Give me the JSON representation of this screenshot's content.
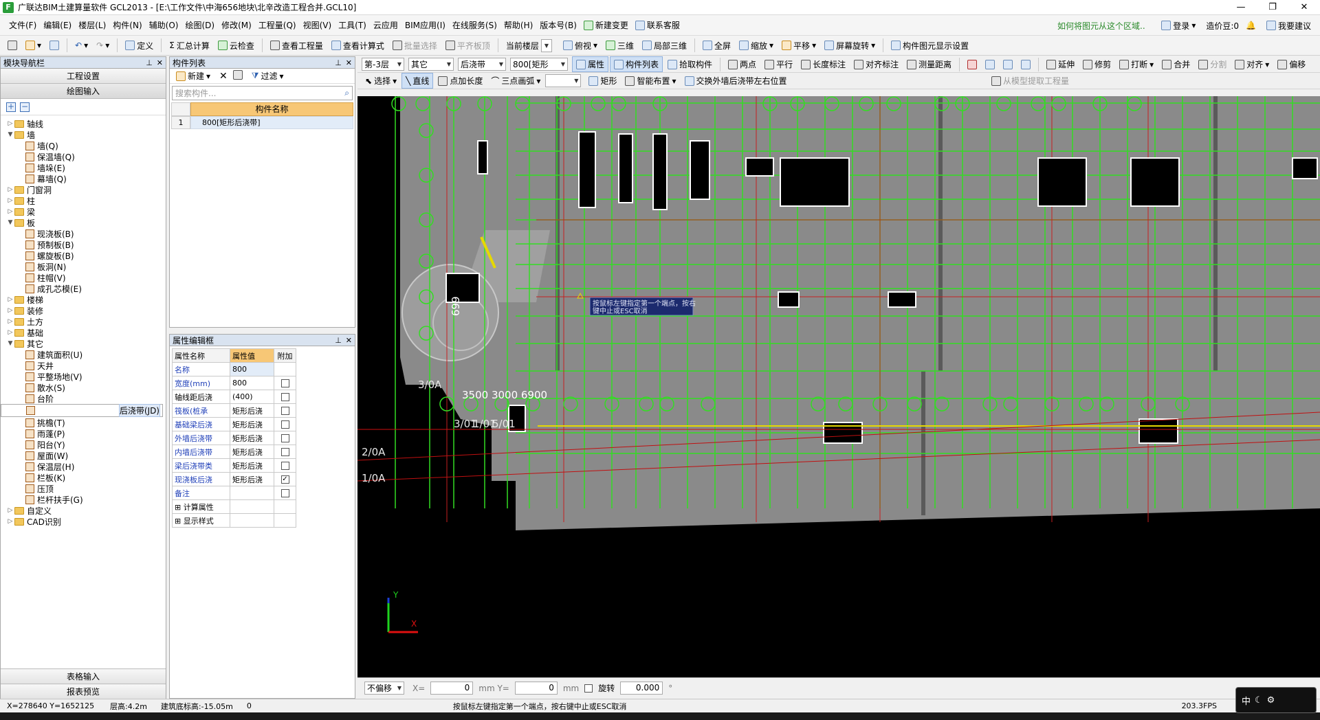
{
  "window": {
    "title": "广联达BIM土建算量软件 GCL2013 - [E:\\工作文件\\中海656地块\\北辛改造工程合并.GCL10]",
    "app_icon": "F",
    "minimize": "—",
    "restore": "❐",
    "close": "✕"
  },
  "menu": {
    "items": [
      "文件(F)",
      "编辑(E)",
      "楼层(L)",
      "构件(N)",
      "辅助(O)",
      "绘图(D)",
      "修改(M)",
      "工程量(Q)",
      "视图(V)",
      "工具(T)",
      "云应用",
      "BIM应用(I)",
      "在线服务(S)",
      "帮助(H)",
      "版本号(B)"
    ],
    "new_change": "新建变更",
    "contact_service": "联系客服",
    "hint_link": "如何将图元从这个区域..",
    "login": "登录",
    "cost_beans": "造价豆:0",
    "suggest": "我要建议"
  },
  "toolbar": {
    "define": "定义",
    "sum_calc": "汇总计算",
    "cloud_check": "云检查",
    "view_quantity": "查看工程量",
    "view_formula": "查看计算式",
    "batch_select": "批量选择",
    "level_slab": "平齐板顶",
    "current_floor": "当前楼层",
    "plan_view": "俯视",
    "three_d": "三维",
    "local_3d": "局部三维",
    "fullscreen": "全屏",
    "zoom": "缩放",
    "pan": "平移",
    "rotate_screen": "屏幕旋转",
    "display_settings": "构件图元显示设置"
  },
  "nav_panel": {
    "title": "模块导航栏",
    "project_settings": "工程设置",
    "drawing_input": "绘图输入",
    "tree": [
      {
        "label": "轴线",
        "level": 0,
        "expanded": false,
        "type": "folder"
      },
      {
        "label": "墙",
        "level": 0,
        "expanded": true,
        "type": "folder"
      },
      {
        "label": "墙(Q)",
        "level": 1,
        "type": "item"
      },
      {
        "label": "保温墙(Q)",
        "level": 1,
        "type": "item"
      },
      {
        "label": "墙垛(E)",
        "level": 1,
        "type": "item"
      },
      {
        "label": "幕墙(Q)",
        "level": 1,
        "type": "item"
      },
      {
        "label": "门窗洞",
        "level": 0,
        "expanded": false,
        "type": "folder"
      },
      {
        "label": "柱",
        "level": 0,
        "expanded": false,
        "type": "folder"
      },
      {
        "label": "梁",
        "level": 0,
        "expanded": false,
        "type": "folder"
      },
      {
        "label": "板",
        "level": 0,
        "expanded": true,
        "type": "folder"
      },
      {
        "label": "现浇板(B)",
        "level": 1,
        "type": "item"
      },
      {
        "label": "预制板(B)",
        "level": 1,
        "type": "item"
      },
      {
        "label": "螺旋板(B)",
        "level": 1,
        "type": "item"
      },
      {
        "label": "板洞(N)",
        "level": 1,
        "type": "item"
      },
      {
        "label": "柱帽(V)",
        "level": 1,
        "type": "item"
      },
      {
        "label": "成孔芯模(E)",
        "level": 1,
        "type": "item"
      },
      {
        "label": "楼梯",
        "level": 0,
        "expanded": false,
        "type": "folder"
      },
      {
        "label": "装修",
        "level": 0,
        "expanded": false,
        "type": "folder"
      },
      {
        "label": "土方",
        "level": 0,
        "expanded": false,
        "type": "folder"
      },
      {
        "label": "基础",
        "level": 0,
        "expanded": false,
        "type": "folder"
      },
      {
        "label": "其它",
        "level": 0,
        "expanded": true,
        "type": "folder"
      },
      {
        "label": "建筑面积(U)",
        "level": 1,
        "type": "item"
      },
      {
        "label": "天井",
        "level": 1,
        "type": "item"
      },
      {
        "label": "平整场地(V)",
        "level": 1,
        "type": "item"
      },
      {
        "label": "散水(S)",
        "level": 1,
        "type": "item"
      },
      {
        "label": "台阶",
        "level": 1,
        "type": "item"
      },
      {
        "label": "后浇带(JD)",
        "level": 1,
        "type": "item",
        "selected": true
      },
      {
        "label": "挑檐(T)",
        "level": 1,
        "type": "item"
      },
      {
        "label": "雨蓬(P)",
        "level": 1,
        "type": "item"
      },
      {
        "label": "阳台(Y)",
        "level": 1,
        "type": "item"
      },
      {
        "label": "屋面(W)",
        "level": 1,
        "type": "item"
      },
      {
        "label": "保温层(H)",
        "level": 1,
        "type": "item"
      },
      {
        "label": "栏板(K)",
        "level": 1,
        "type": "item"
      },
      {
        "label": "压顶",
        "level": 1,
        "type": "item"
      },
      {
        "label": "栏杆扶手(G)",
        "level": 1,
        "type": "item"
      },
      {
        "label": "自定义",
        "level": 0,
        "expanded": false,
        "type": "folder"
      },
      {
        "label": "CAD识别",
        "level": 0,
        "expanded": false,
        "type": "folder"
      }
    ],
    "table_input": "表格输入",
    "report_preview": "报表预览"
  },
  "component_list": {
    "title": "构件列表",
    "new": "新建",
    "filter": "过滤",
    "search_placeholder": "搜索构件...",
    "col_header": "构件名称",
    "rows": [
      {
        "index": "1",
        "name": "800[矩形后浇带]"
      }
    ]
  },
  "property_editor": {
    "title": "属性编辑框",
    "headers": [
      "属性名称",
      "属性值",
      "附加"
    ],
    "rows": [
      {
        "name": "名称",
        "value": "800",
        "extra": "",
        "blue": true
      },
      {
        "name": "宽度(mm)",
        "value": "800",
        "extra": "box",
        "blue": true
      },
      {
        "name": "轴线距后浇",
        "value": "(400)",
        "extra": "box",
        "blue": false
      },
      {
        "name": "筏板(桩承",
        "value": "矩形后浇",
        "extra": "box",
        "blue": true
      },
      {
        "name": "基础梁后浇",
        "value": "矩形后浇",
        "extra": "box",
        "blue": true
      },
      {
        "name": "外墙后浇带",
        "value": "矩形后浇",
        "extra": "box",
        "blue": true
      },
      {
        "name": "内墙后浇带",
        "value": "矩形后浇",
        "extra": "box",
        "blue": true
      },
      {
        "name": "梁后浇带类",
        "value": "矩形后浇",
        "extra": "box",
        "blue": true
      },
      {
        "name": "现浇板后浇",
        "value": "矩形后浇",
        "extra": "checked",
        "blue": true
      },
      {
        "name": "备注",
        "value": "",
        "extra": "box",
        "blue": true
      },
      {
        "name": "计算属性",
        "value": "",
        "extra": "",
        "blue": false,
        "group": true
      },
      {
        "name": "显示样式",
        "value": "",
        "extra": "",
        "blue": false,
        "group": true
      }
    ]
  },
  "draw_toolbar1": {
    "floor": "第-3层",
    "category": "其它",
    "type": "后浇带",
    "component": "800[矩形",
    "properties": "属性",
    "comp_list": "构件列表",
    "pick": "拾取构件",
    "two_points": "两点",
    "parallel": "平行",
    "length_mark": "长度标注",
    "align_mark": "对齐标注",
    "measure": "测量距离",
    "extend": "延伸",
    "trim": "修剪",
    "break": "打断",
    "merge": "合并",
    "split": "分割",
    "align": "对齐",
    "offset": "偏移"
  },
  "draw_toolbar2": {
    "select": "选择",
    "line": "直线",
    "point_length": "点加长度",
    "three_point_arc": "三点画弧",
    "rect": "矩形",
    "smart_layout": "智能布置",
    "swap_sides": "交换外墙后浇带左右位置",
    "extract": "从模型提取工程量"
  },
  "canvas": {
    "tooltip_line1": "按鼠标左键指定第一个端点，按右",
    "tooltip_line2": "键中止或ESC取消",
    "axis_labels": [
      "3/0A",
      "2/0A",
      "1/0A",
      "3/01",
      "1/01",
      "5/01"
    ],
    "dim_text": "3500 3000 6900",
    "wall_label": "699",
    "axis_y": "Y",
    "axis_x": "X"
  },
  "statusbar": {
    "offset_mode": "不偏移",
    "x_label": "X=",
    "x_value": "0",
    "y_label": "mm Y=",
    "y_value": "0",
    "unit": "mm",
    "rotate_label": "旋转",
    "rotate_value": "0.000",
    "degree": "°"
  },
  "bottom": {
    "coords": "X=278640 Y=1652125",
    "floor_height": "层高:4.2m",
    "base_elev": "建筑底标高:-15.05m",
    "zero": "0",
    "prompt": "按鼠标左键指定第一个端点，按右键中止或ESC取消",
    "fps": "203.3FPS",
    "ime": "中"
  }
}
